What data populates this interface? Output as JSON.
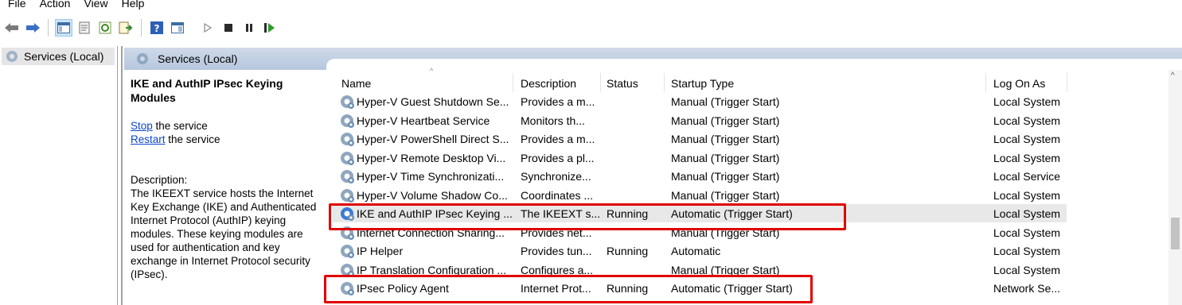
{
  "menu": [
    "File",
    "Action",
    "View",
    "Help"
  ],
  "toolbar": {
    "icons": [
      "back-arrow-icon",
      "forward-arrow-icon",
      "show-hide-tree-icon",
      "properties-icon",
      "refresh-icon",
      "export-list-icon",
      "help-icon",
      "console-pane-icon",
      "play-icon",
      "stop-icon",
      "pause-icon",
      "restart-icon"
    ]
  },
  "tree": {
    "item": "Services (Local)"
  },
  "header": {
    "title": "Services (Local)"
  },
  "detail": {
    "title": "IKE and AuthIP IPsec Keying Modules",
    "stop_link": "Stop",
    "stop_rest": " the service",
    "restart_link": "Restart",
    "restart_rest": " the service",
    "desc_label": "Description:",
    "desc_text": "The IKEEXT service hosts the Internet Key Exchange (IKE) and Authenticated Internet Protocol (AuthIP) keying modules. These keying modules are used for authentication and key exchange in Internet Protocol security (IPsec)."
  },
  "columns": {
    "name": "Name",
    "description": "Description",
    "status": "Status",
    "startup": "Startup Type",
    "logon": "Log On As"
  },
  "rows": [
    {
      "name": "Hyper-V Guest Shutdown Se...",
      "description": "Provides a m...",
      "status": "",
      "startup": "Manual (Trigger Start)",
      "logon": "Local System"
    },
    {
      "name": "Hyper-V Heartbeat Service",
      "description": "Monitors th...",
      "status": "",
      "startup": "Manual (Trigger Start)",
      "logon": "Local System"
    },
    {
      "name": "Hyper-V PowerShell Direct S...",
      "description": "Provides a m...",
      "status": "",
      "startup": "Manual (Trigger Start)",
      "logon": "Local System"
    },
    {
      "name": "Hyper-V Remote Desktop Vi...",
      "description": "Provides a pl...",
      "status": "",
      "startup": "Manual (Trigger Start)",
      "logon": "Local System"
    },
    {
      "name": "Hyper-V Time Synchronizati...",
      "description": "Synchronize...",
      "status": "",
      "startup": "Manual (Trigger Start)",
      "logon": "Local Service"
    },
    {
      "name": "Hyper-V Volume Shadow Co...",
      "description": "Coordinates ...",
      "status": "",
      "startup": "Manual (Trigger Start)",
      "logon": "Local System"
    },
    {
      "name": "IKE and AuthIP IPsec Keying ...",
      "description": "The IKEEXT s...",
      "status": "Running",
      "startup": "Automatic (Trigger Start)",
      "logon": "Local System"
    },
    {
      "name": "Internet Connection Sharing...",
      "description": "Provides net...",
      "status": "",
      "startup": "Manual (Trigger Start)",
      "logon": "Local System"
    },
    {
      "name": "IP Helper",
      "description": "Provides tun...",
      "status": "Running",
      "startup": "Automatic",
      "logon": "Local System"
    },
    {
      "name": "IP Translation Configuration ...",
      "description": "Configures a...",
      "status": "",
      "startup": "Manual (Trigger Start)",
      "logon": "Local System"
    },
    {
      "name": "IPsec Policy Agent",
      "description": "Internet Prot...",
      "status": "Running",
      "startup": "Automatic (Trigger Start)",
      "logon": "Network Se..."
    }
  ],
  "colors": {
    "highlight_box": "#e00000",
    "link": "#0b46c8",
    "header_band": "#b6c7de"
  }
}
